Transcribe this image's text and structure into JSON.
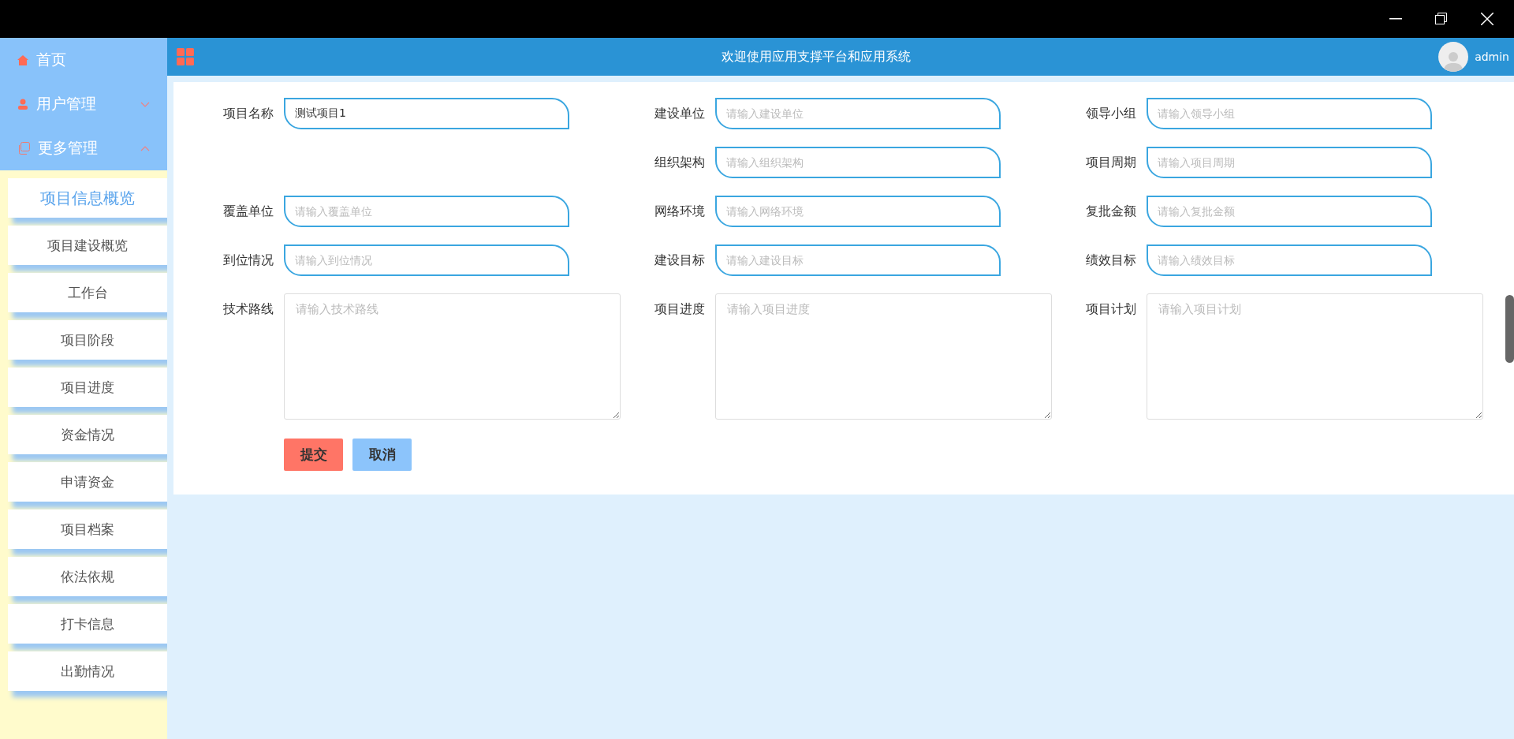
{
  "header": {
    "title": "欢迎使用应用支撑平台和应用系统",
    "user": "admin"
  },
  "menu": [
    {
      "label": "首页",
      "kind": "home"
    },
    {
      "label": "用户管理",
      "kind": "user",
      "expanded": false
    },
    {
      "label": "更多管理",
      "kind": "copy",
      "expanded": true,
      "children": [
        {
          "label": "项目信息概览",
          "selected": true
        },
        {
          "label": "项目建设概览",
          "selected": false
        },
        {
          "label": "工作台",
          "selected": false
        },
        {
          "label": "项目阶段",
          "selected": false
        },
        {
          "label": "项目进度",
          "selected": false
        },
        {
          "label": "资金情况",
          "selected": false
        },
        {
          "label": "申请资金",
          "selected": false
        },
        {
          "label": "项目档案",
          "selected": false
        },
        {
          "label": "依法依规",
          "selected": false
        },
        {
          "label": "打卡信息",
          "selected": false
        },
        {
          "label": "出勤情况",
          "selected": false
        }
      ]
    }
  ],
  "form": {
    "rows": [
      [
        {
          "label": "项目名称",
          "kind": "input",
          "value": "测试项目1"
        },
        {
          "label": "建设单位",
          "kind": "input",
          "placeholder": "请输入建设单位"
        },
        {
          "label": "领导小组",
          "kind": "input",
          "placeholder": "请输入领导小组"
        }
      ],
      [
        null,
        {
          "label": "组织架构",
          "kind": "input",
          "placeholder": "请输入组织架构"
        },
        {
          "label": "项目周期",
          "kind": "input",
          "placeholder": "请输入项目周期"
        }
      ],
      [
        {
          "label": "覆盖单位",
          "kind": "input",
          "placeholder": "请输入覆盖单位"
        },
        {
          "label": "网络环境",
          "kind": "input",
          "placeholder": "请输入网络环境"
        },
        {
          "label": "复批金额",
          "kind": "input",
          "placeholder": "请输入复批金额"
        }
      ],
      [
        {
          "label": "到位情况",
          "kind": "input",
          "placeholder": "请输入到位情况"
        },
        {
          "label": "建设目标",
          "kind": "input",
          "placeholder": "请输入建设目标"
        },
        {
          "label": "绩效目标",
          "kind": "input",
          "placeholder": "请输入绩效目标"
        }
      ],
      [
        {
          "label": "技术路线",
          "kind": "textarea",
          "placeholder": "请输入技术路线"
        },
        {
          "label": "项目进度",
          "kind": "textarea",
          "placeholder": "请输入项目进度"
        },
        {
          "label": "项目计划",
          "kind": "textarea",
          "placeholder": "请输入项目计划"
        }
      ]
    ],
    "buttons": [
      {
        "label": "提交",
        "kind": "primary"
      },
      {
        "label": "取消",
        "kind": "secondary"
      }
    ]
  }
}
